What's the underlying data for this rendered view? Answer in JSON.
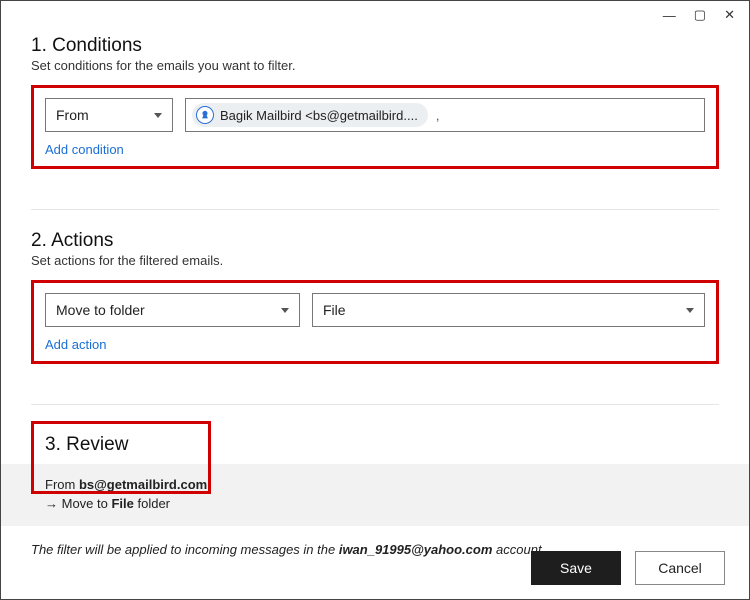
{
  "titlebar": {
    "min": "—",
    "max": "▢",
    "close": "✕"
  },
  "conditions": {
    "title": "1. Conditions",
    "sub": "Set conditions for the emails you want to filter.",
    "field_label": "From",
    "chip_text": "Bagik Mailbird  <bs@getmailbird....",
    "trailing": ",",
    "add": "Add condition"
  },
  "actions": {
    "title": "2. Actions",
    "sub": "Set actions for the filtered emails.",
    "action_label": "Move to folder",
    "folder_label": "File",
    "add": "Add action"
  },
  "review": {
    "title": "3. Review",
    "line1_pre": "From ",
    "line1_bold": "bs@getmailbird.com",
    "line2_pre": "→  Move to ",
    "line2_bold": "File",
    "line2_post": " folder"
  },
  "footer": {
    "pre": "The filter will be applied to incoming messages in the ",
    "bold": "iwan_91995@yahoo.com",
    "post": " account."
  },
  "buttons": {
    "save": "Save",
    "cancel": "Cancel"
  }
}
